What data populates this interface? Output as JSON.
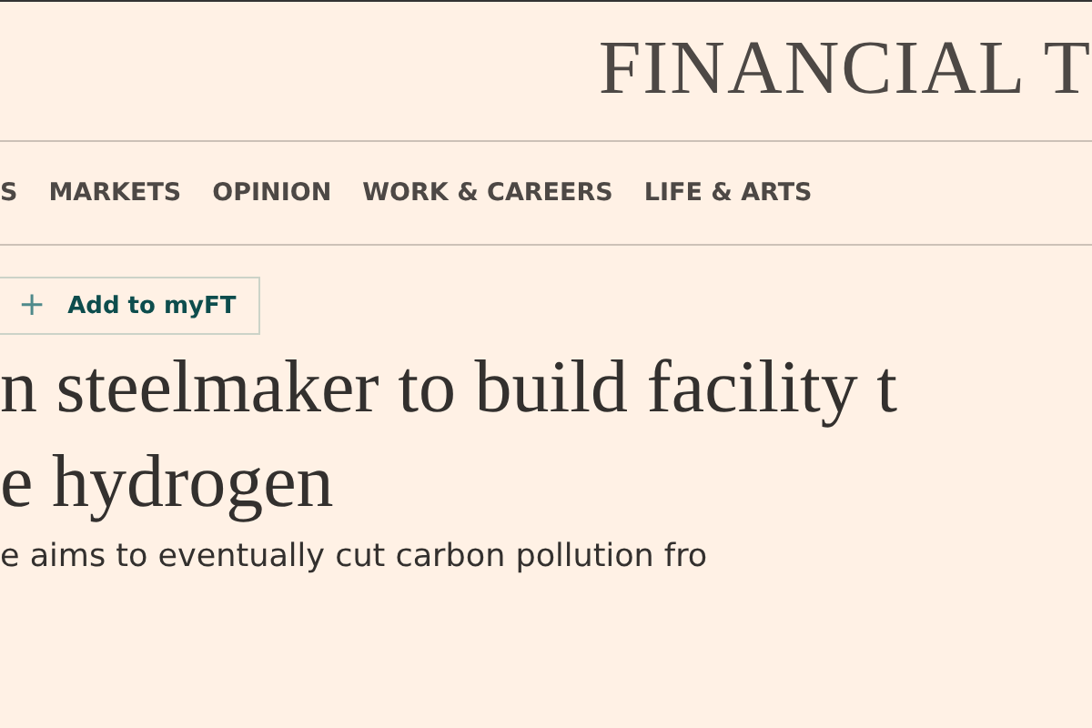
{
  "masthead": {
    "title": "FINANCIAL T"
  },
  "nav": [
    {
      "label": "S"
    },
    {
      "label": "MARKETS"
    },
    {
      "label": "OPINION"
    },
    {
      "label": "WORK & CAREERS"
    },
    {
      "label": "LIFE & ARTS"
    }
  ],
  "follow_button": {
    "icon": "+",
    "label": "Add to myFT"
  },
  "headline": [
    "n steelmaker to build facility t",
    "e hydrogen"
  ],
  "standfirst": "e aims to eventually cut carbon pollution fro"
}
